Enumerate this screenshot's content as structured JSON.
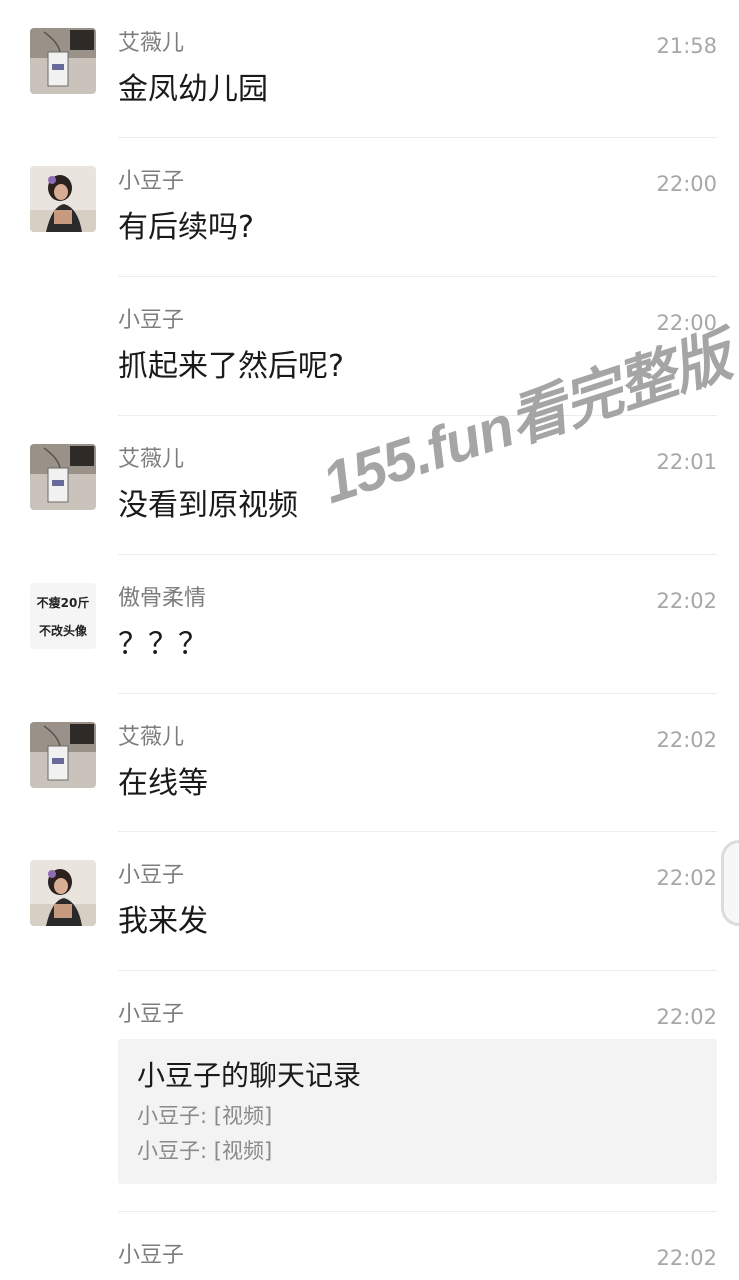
{
  "messages": [
    {
      "sender": "艾薇儿",
      "time": "21:58",
      "text": "金凤幼儿园"
    },
    {
      "sender": "小豆子",
      "time": "22:00",
      "text": "有后续吗?"
    },
    {
      "sender": "小豆子",
      "time": "22:00",
      "text": "抓起来了然后呢?"
    },
    {
      "sender": "艾薇儿",
      "time": "22:01",
      "text": "没看到原视频"
    },
    {
      "sender": "傲骨柔情",
      "time": "22:02",
      "text": "？？？",
      "avatar_text": [
        "不瘦20斤",
        "不改头像"
      ]
    },
    {
      "sender": "艾薇儿",
      "time": "22:02",
      "text": "在线等"
    },
    {
      "sender": "小豆子",
      "time": "22:02",
      "text": "我来发"
    },
    {
      "sender": "小豆子",
      "time": "22:02",
      "card": {
        "title": "小豆子的聊天记录",
        "lines": [
          "小豆子: [视频]",
          "小豆子: [视频]"
        ]
      }
    },
    {
      "sender": "小豆子",
      "time": "22:02"
    }
  ],
  "watermark": "155.fun看完整版",
  "colors": {
    "background": "#ffffff",
    "sender": "#7d7d7d",
    "time": "#a7a7a7",
    "text": "#1a1a1a",
    "card_bg": "#f3f3f3"
  }
}
